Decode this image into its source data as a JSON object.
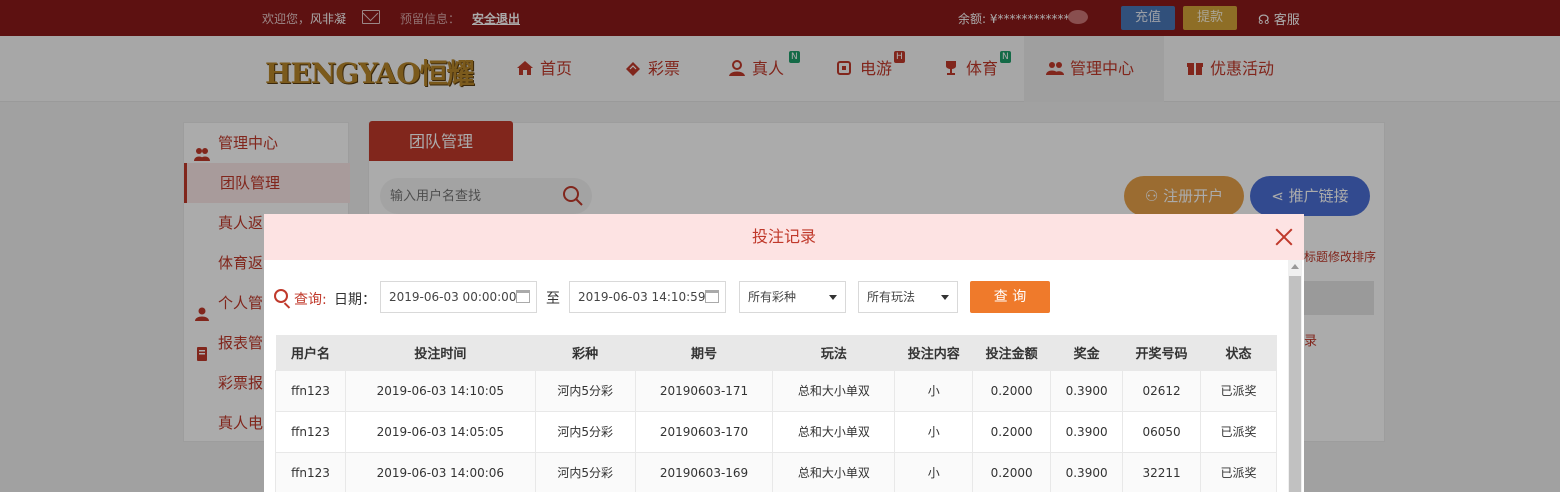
{
  "topbar": {
    "welcome_prefix": "欢迎您，",
    "username": "风非凝",
    "notice": "预留信息：",
    "logout": "安全退出",
    "balance": "余额: ¥*************",
    "recharge": "充值",
    "withdraw": "提款",
    "service": "客服"
  },
  "header": {
    "logo": "HENGYAO恒耀",
    "nav": [
      {
        "label": "首页",
        "icon": "home-icon"
      },
      {
        "label": "彩票",
        "icon": "ticket-icon"
      },
      {
        "label": "真人",
        "icon": "dealer-icon",
        "badge": "N"
      },
      {
        "label": "电游",
        "icon": "arcade-icon",
        "badge": "H"
      },
      {
        "label": "体育",
        "icon": "trophy-icon",
        "badge": "N"
      },
      {
        "label": "管理中心",
        "icon": "users-icon"
      },
      {
        "label": "优惠活动",
        "icon": "gift-icon"
      }
    ]
  },
  "sidebar": {
    "items": [
      {
        "label": "管理中心"
      },
      {
        "label": "团队管理"
      },
      {
        "label": "真人返"
      },
      {
        "label": "体育返"
      },
      {
        "label": "个人管"
      },
      {
        "label": "报表管"
      },
      {
        "label": "彩票报"
      },
      {
        "label": "真人电"
      }
    ]
  },
  "page": {
    "tab_title": "团队管理",
    "search_placeholder": "输入用户名查找",
    "register_button": "注册开户",
    "promo_button": "推广链接",
    "sort_hint": "标题修改排序",
    "row_link": "录"
  },
  "modal": {
    "title": "投注记录",
    "filter": {
      "query_label": "查询:",
      "date_label": "日期：",
      "start_date": "2019-06-03 00:00:00",
      "to_label": "至",
      "end_date": "2019-06-03 14:10:59",
      "lottery_select": "所有彩种",
      "play_select": "所有玩法",
      "query_button": "查 询"
    },
    "table": {
      "columns": [
        "用户名",
        "投注时间",
        "彩种",
        "期号",
        "玩法",
        "投注内容",
        "投注金额",
        "奖金",
        "开奖号码",
        "状态"
      ],
      "rows": [
        [
          "ffn123",
          "2019-06-03 14:10:05",
          "河内5分彩",
          "20190603-171",
          "总和大小单双",
          "小",
          "0.2000",
          "0.3900",
          "02612",
          "已派奖"
        ],
        [
          "ffn123",
          "2019-06-03 14:05:05",
          "河内5分彩",
          "20190603-170",
          "总和大小单双",
          "小",
          "0.2000",
          "0.3900",
          "06050",
          "已派奖"
        ],
        [
          "ffn123",
          "2019-06-03 14:00:06",
          "河内5分彩",
          "20190603-169",
          "总和大小单双",
          "小",
          "0.2000",
          "0.3900",
          "32211",
          "已派奖"
        ]
      ]
    }
  },
  "colors": {
    "brand_red": "#c0392b",
    "topbar": "#8b1a1a",
    "modal_header": "#fde3e3",
    "query_button": "#ef7a2b"
  }
}
